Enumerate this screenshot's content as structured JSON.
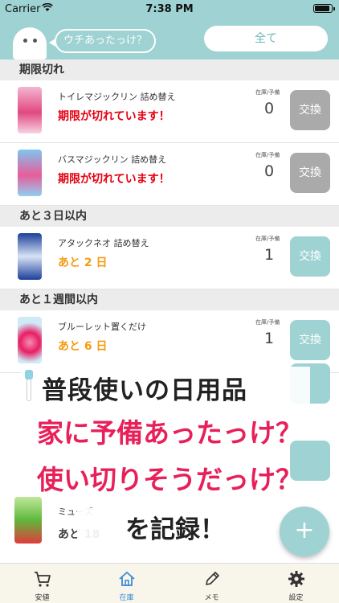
{
  "status_bar": {
    "carrier": "Carrier",
    "time": "7:38 PM"
  },
  "header": {
    "bubble_text": "ウチあったっけ？",
    "filter_label": "全て"
  },
  "stock_label": "在庫/予備",
  "swap_label": "交換",
  "sections": [
    {
      "title": "期限切れ",
      "items": [
        {
          "name": "トイレマジックリン 詰め替え",
          "status": "期限が切れています！",
          "stock": "0"
        },
        {
          "name": "バスマジックリン 詰め替え",
          "status": "期限が切れています！",
          "stock": "0"
        }
      ]
    },
    {
      "title": "あと３日以内",
      "items": [
        {
          "name": "アタックネオ 詰め替え",
          "status": "あと 2 日",
          "stock": "1"
        }
      ]
    },
    {
      "title": "あと１週間以内",
      "items": [
        {
          "name": "ブルーレット置くだけ",
          "status": "あと 6 日",
          "stock": "1"
        }
      ]
    }
  ],
  "partial_item": {
    "name": "ミューズ",
    "status": "あと 18"
  },
  "promo": {
    "line1": "普段使いの日用品",
    "line2": "家に予備あったっけ？",
    "line3": "使い切りそうだっけ？",
    "line4": "を記録！"
  },
  "fab_label": "+",
  "tabs": [
    {
      "label": "安値",
      "icon": "cart-icon"
    },
    {
      "label": "在庫",
      "icon": "home-icon"
    },
    {
      "label": "メモ",
      "icon": "pencil-icon"
    },
    {
      "label": "設定",
      "icon": "gear-icon"
    }
  ],
  "colors": {
    "header": "#9fd2d2",
    "expired": "#e60012",
    "soon": "#f39c12",
    "active_tab": "#3b8bd7",
    "promo_pink": "#e8205a"
  }
}
